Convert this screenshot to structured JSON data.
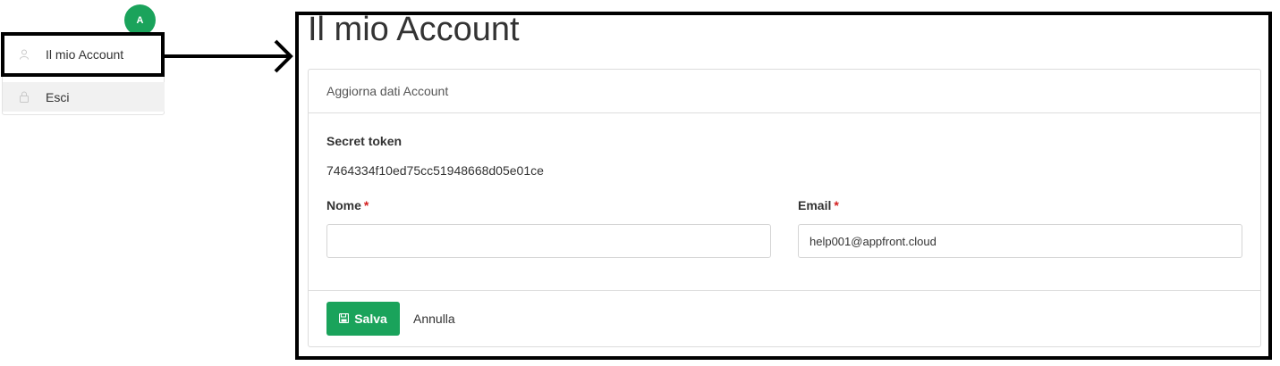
{
  "user_menu": {
    "avatar_initial": "A",
    "items": [
      {
        "label": "Il mio Account",
        "icon": "user-icon"
      },
      {
        "label": "Esci",
        "icon": "lock-icon"
      }
    ]
  },
  "page": {
    "title": "Il mio Account"
  },
  "card": {
    "header": "Aggiorna dati Account",
    "secret_token_label": "Secret token",
    "secret_token_value": "7464334f10ed75cc51948668d05e01ce",
    "nome_label": "Nome",
    "nome_value": "",
    "email_label": "Email",
    "email_value": "help001@appfront.cloud",
    "required_mark": "*",
    "save_label": "Salva",
    "cancel_label": "Annulla"
  },
  "colors": {
    "accent": "#1aa35b",
    "required": "#d42020",
    "highlight": "#000000"
  }
}
